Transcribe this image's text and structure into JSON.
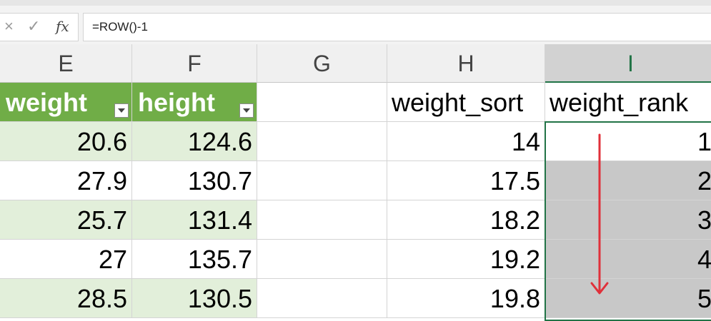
{
  "formula_bar": {
    "cancel_icon": "×",
    "enter_icon": "✓",
    "fx_label": "fx",
    "formula": "=ROW()-1"
  },
  "columns": [
    "E",
    "F",
    "G",
    "H",
    "I"
  ],
  "selected_column": "I",
  "headers": {
    "weight": "weight",
    "height": "height",
    "weight_sort": "weight_sort",
    "weight_rank": "weight_rank"
  },
  "rows": [
    {
      "weight": "20.6",
      "height": "124.6",
      "weight_sort": "14",
      "weight_rank": "1"
    },
    {
      "weight": "27.9",
      "height": "130.7",
      "weight_sort": "17.5",
      "weight_rank": "2"
    },
    {
      "weight": "25.7",
      "height": "131.4",
      "weight_sort": "18.2",
      "weight_rank": "3"
    },
    {
      "weight": "27",
      "height": "135.7",
      "weight_sort": "19.2",
      "weight_rank": "4"
    },
    {
      "weight": "28.5",
      "height": "130.5",
      "weight_sort": "19.8",
      "weight_rank": "5"
    }
  ],
  "colors": {
    "table_header": "#70ad47",
    "table_band": "#e2efda",
    "selection": "#c8c8c8",
    "active_accent": "#217346",
    "arrow": "#e0303a"
  },
  "annotation_arrow": "down-arrow"
}
